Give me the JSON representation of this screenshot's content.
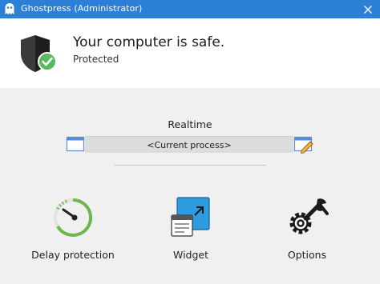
{
  "window": {
    "title": "Ghostpress (Administrator)"
  },
  "status": {
    "headline": "Your computer is safe.",
    "subtext": "Protected"
  },
  "realtime": {
    "label": "Realtime",
    "value": "<Current process>"
  },
  "features": [
    {
      "label": "Delay protection",
      "icon": "gauge-icon"
    },
    {
      "label": "Widget",
      "icon": "widget-icon"
    },
    {
      "label": "Options",
      "icon": "gear-wrench-icon"
    }
  ],
  "colors": {
    "titlebar": "#2b7fd6",
    "accent_green": "#5cb85c",
    "body_bg": "#f0f0f0"
  }
}
